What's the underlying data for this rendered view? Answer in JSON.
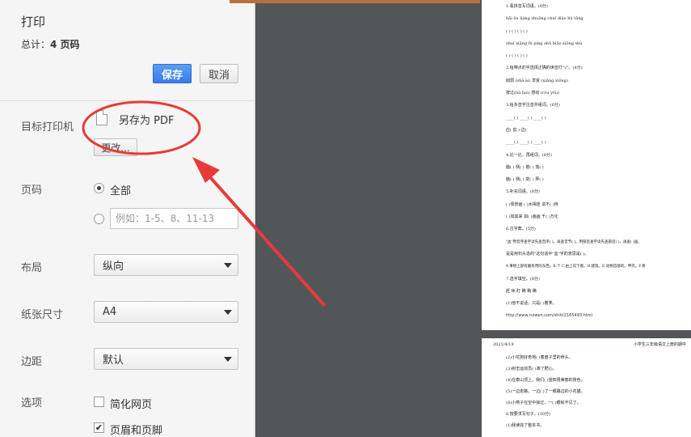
{
  "panel": {
    "title": "打印",
    "total_prefix": "总计：",
    "total_value": "4 页码",
    "save_label": "保存",
    "cancel_label": "取消"
  },
  "destination": {
    "label": "目标打印机",
    "name": "另存为 PDF",
    "change_label": "更改..."
  },
  "pages": {
    "label": "页码",
    "all_label": "全部",
    "range_placeholder": "例如：1-5、8、11-13"
  },
  "layout": {
    "label": "布局",
    "value": "纵向"
  },
  "paper_size": {
    "label": "纸张尺寸",
    "value": "A4"
  },
  "margins": {
    "label": "边距",
    "value": "默认"
  },
  "options": {
    "label": "选项",
    "simplify_label": "简化网页",
    "simplify_checked": false,
    "headers_label": "页眉和页脚",
    "headers_checked": true
  },
  "annotation": {
    "color": "#e83a3a"
  },
  "preview": {
    "page1_lines": [
      "1.看拼音写词语。(8分)",
      "hǎi ōu liáng shuǎng chuí diào liú tǎng",
      "(  ) (  ) (  ) (  )",
      "shuǐ xiǎng fū píng shū biǎo xiōng shù",
      "(  ) (  ) (  ) (  )",
      "2.给带点的字选择正确的读音打\"√\"。(4分)",
      "削弱 (shà ai) 享受 (xiǎng xiōng)",
      "按过(liú luò) 感动 (róu yǒu)",
      "3.给多音字注音并组词。(6分)",
      "____(  ) ____(  ) ____(  )",
      "应( 剪 ) 边(",
      "____(  ) ____(  ) ____(  )",
      "4.比一比，再组词。(8分)",
      "脑(  ) 侧(  ) 按(  ) 落(  )",
      "脑(  ) 侧(  ) 变(  ) 弄(  )",
      "5.补充词语。(8分)",
      "(  )观管画 (  )水相连 造不(  )待",
      "(  )如其来 如(  )画画 千(  )万化",
      "6.古字典。(5分)",
      "\"血\"用音序查字读先查音序(  )，再查音节(  )。用部首查字读先查部首(  )，再查(  )画。",
      "是是用石头造的\"这句话中\"血\"字的意思是(  )。",
      "4.事物上部有趣有用的东西。B.个 C.由上向下看。D.建筑。E.动物首部的。甲壳。F.骨",
      "7.选字填空。(8分)",
      "赶 休 盯 瞧 瞧 瞅",
      "(1)他不说话，只是(  )着笑。"
    ],
    "page1_url": "http://www.ruiwen.com/shiti/2165493.html",
    "page2_date": "2021/4/19",
    "page2_header": "小学生三年级语文上册的期中",
    "page2_lines": [
      "(2)小花狗好奇地(  )着盘子里的骨头。",
      "(3)射击运动员(  )准了靶心。",
      "(4)在泰山顶上，我们(  )望四周美丽的景色。",
      "(5)一边走路，一边(  )了一眼路边的小花猫。",
      "(6)小燕子在空中掠过，一(  )眼就不见了。",
      "8.按要求写句子。(10分)",
      "(1)我读完了整本书。"
    ]
  }
}
